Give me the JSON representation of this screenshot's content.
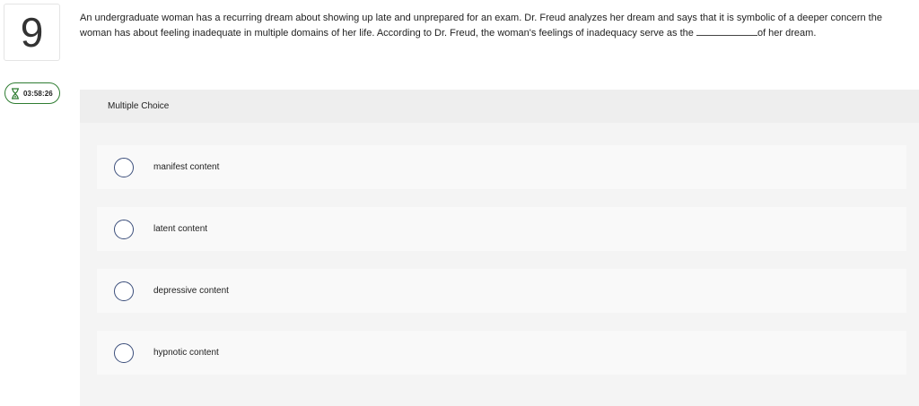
{
  "question": {
    "number": "9",
    "prompt_before_blank": "An undergraduate woman has a recurring dream about showing up late and unprepared for an exam. Dr. Freud analyzes her dream and says that it is symbolic of a deeper concern the woman has about feeling inadequate in multiple domains of her life. According to Dr. Freud, the woman's feelings of inadequacy serve as the ",
    "prompt_after_blank": "of her dream."
  },
  "timer": {
    "value": "03:58:26",
    "icon": "hourglass-icon",
    "color": "#2f7d32"
  },
  "answer_panel": {
    "type_label": "Multiple Choice",
    "options": [
      {
        "label": "manifest content"
      },
      {
        "label": "latent content"
      },
      {
        "label": "depressive content"
      },
      {
        "label": "hypnotic content"
      }
    ]
  },
  "colors": {
    "radio_border": "#3a4d7a",
    "panel_bg": "#f4f4f4",
    "option_bg": "#f9f9f9"
  }
}
